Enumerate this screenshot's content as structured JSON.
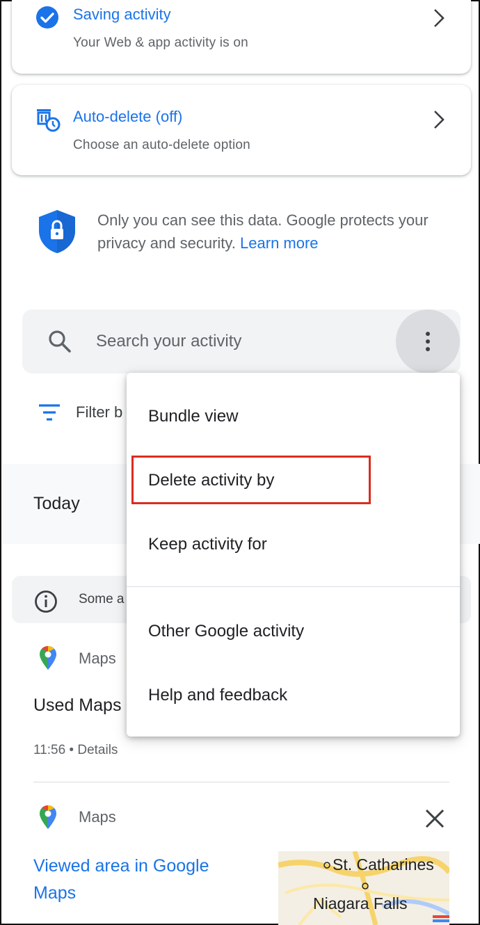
{
  "cards": {
    "saving": {
      "title": "Saving activity",
      "subtitle": "Your Web & app activity is on"
    },
    "autodelete": {
      "title": "Auto-delete (off)",
      "subtitle": "Choose an auto-delete option"
    }
  },
  "privacy": {
    "text": "Only you can see this data. Google protects your privacy and security.",
    "link": "Learn more"
  },
  "search": {
    "placeholder": "Search your activity"
  },
  "filter": {
    "label": "Filter b"
  },
  "today": "Today",
  "info": {
    "text": "Some a"
  },
  "activity": [
    {
      "app": "Maps",
      "title": "Used Maps",
      "time": "11:56",
      "separator": "•",
      "details": "Details"
    },
    {
      "app": "Maps",
      "title": "Viewed area in Google Maps"
    }
  ],
  "map_thumb": {
    "labels": [
      "St. Catharines",
      "Niagara Falls"
    ]
  },
  "menu": {
    "items": [
      "Bundle view",
      "Delete activity by",
      "Keep activity for",
      "Other Google activity",
      "Help and feedback"
    ],
    "highlighted": "Delete activity by"
  },
  "colors": {
    "accent": "#1a73e8",
    "highlight": "#d92d20",
    "text_secondary": "#5f6368"
  }
}
